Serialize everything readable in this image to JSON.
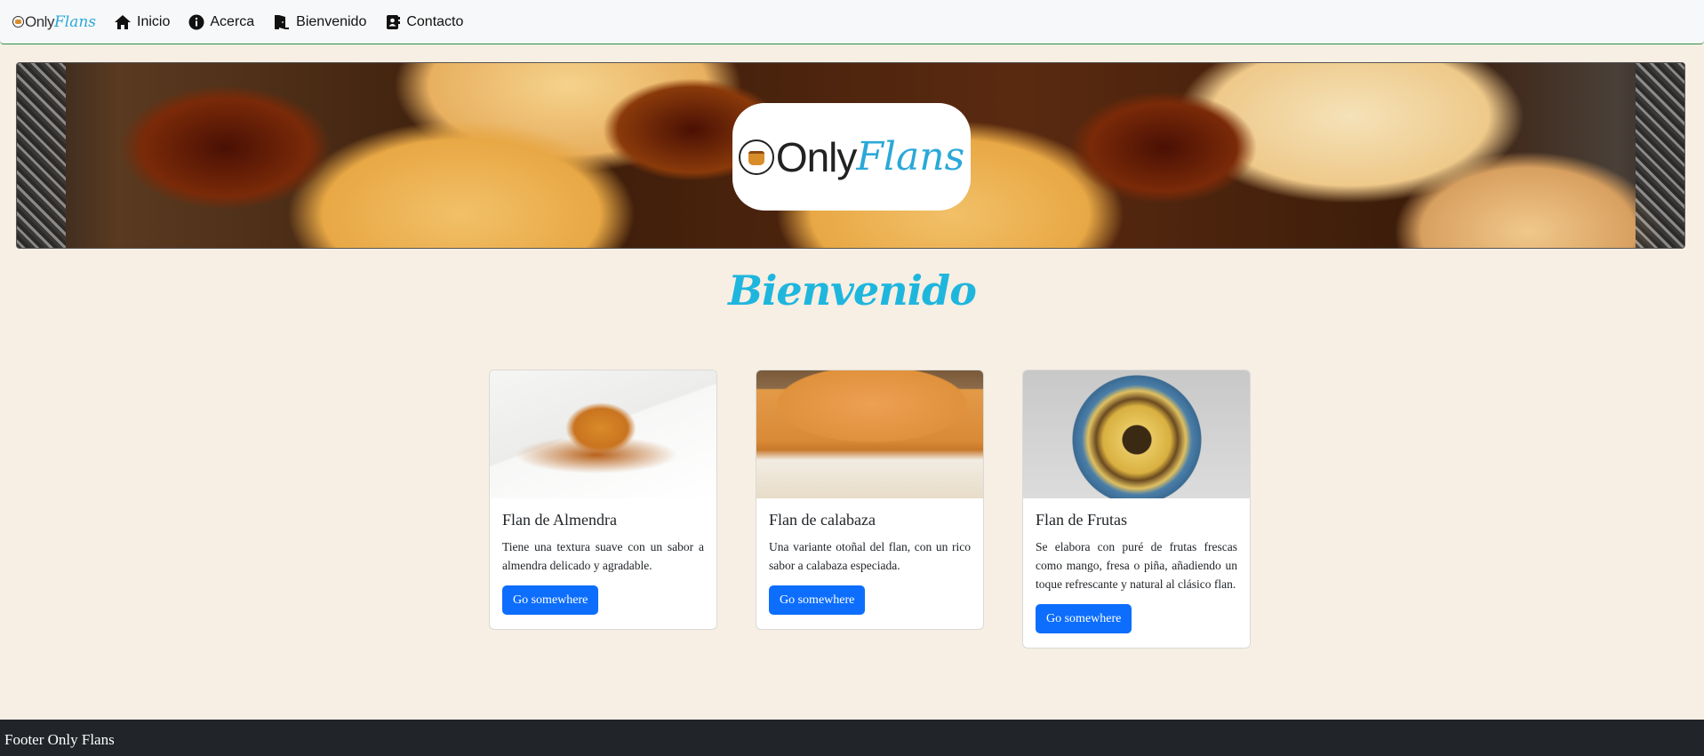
{
  "navbar": {
    "brand_only": "Only",
    "brand_flans": "Flans",
    "items": [
      {
        "label": "Inicio",
        "icon": "home-icon"
      },
      {
        "label": "Acerca",
        "icon": "info-circle-icon"
      },
      {
        "label": "Bienvenido",
        "icon": "door-open-icon"
      },
      {
        "label": "Contacto",
        "icon": "contact-book-icon"
      }
    ]
  },
  "hero": {
    "logo_only": "Only",
    "logo_flans": "Flans"
  },
  "main": {
    "title": "Bienvenido",
    "title_color": "#1fb6de"
  },
  "cards": [
    {
      "title": "Flan de Almendra",
      "text": "Tiene una textura suave con un sabor a almendra delicado y agradable.",
      "button": "Go somewhere"
    },
    {
      "title": "Flan de calabaza",
      "text": "Una variante otoñal del flan, con un rico sabor a calabaza especiada.",
      "button": "Go somewhere"
    },
    {
      "title": "Flan de Frutas",
      "text": "Se elabora con puré de frutas frescas como mango, fresa o piña, añadiendo un toque refrescante y natural al clásico flan.",
      "button": "Go somewhere"
    }
  ],
  "colors": {
    "page_bg": "#f7efe3",
    "button": "#0d6efd",
    "footer_bg": "#212529",
    "brand_accent": "#2aa8d8"
  },
  "footer": {
    "text": "Footer Only Flans"
  }
}
